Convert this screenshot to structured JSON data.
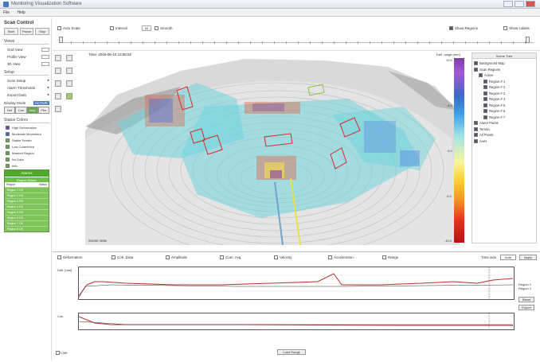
{
  "window": {
    "title": "Monitoring Visualization Software"
  },
  "menu": [
    "File",
    "Help"
  ],
  "sidebar": {
    "title": "Scan Control",
    "buttons": [
      "Start",
      "Pause",
      "Stop"
    ],
    "views_header": "Views",
    "views": [
      "Grid View",
      "Profile View",
      "3D View"
    ],
    "setup_header": "Setup",
    "setup": [
      "Scan Setup",
      "Alarm Thresholds",
      "Export Data"
    ],
    "display_mode_label": "Display Mode",
    "display_mode_tag": "ACTIVE",
    "modes": [
      "Def",
      "Coh",
      "Amp",
      "Phs"
    ],
    "legend_title": "Status Colors",
    "legend": [
      {
        "label": "High Deformation",
        "color": "#7b3fa8"
      },
      {
        "label": "Moderate Movement",
        "color": "#3f66c9"
      },
      {
        "label": "Stable Terrain",
        "color": "#6aa84f"
      },
      {
        "label": "Low Coherence",
        "color": "#6aa84f"
      },
      {
        "label": "Masked Region",
        "color": "#6aa84f"
      },
      {
        "label": "No Data",
        "color": "#6aa84f"
      },
      {
        "label": "Info",
        "color": "#6aa84f"
      }
    ],
    "table": {
      "header": "Alarms",
      "subheader": "Region Status",
      "columns": [
        "Region",
        "Status"
      ],
      "rows": [
        "Region 1  OK",
        "Region 2  OK",
        "Region 3  OK",
        "Region 4  OK",
        "Region 5  OK",
        "Region 6  OK",
        "Region 7  OK",
        "Region 8  OK"
      ]
    }
  },
  "top": {
    "chk_auto": "Auto Scale",
    "chk_interval": "Interval",
    "interval_value": "60",
    "chk_smooth": "Smooth",
    "chk_right1": "Show Regions",
    "chk_right2": "Show Labels"
  },
  "viewport": {
    "header": "Time: 2015-06-10 13:50:52",
    "footer": "Scene view",
    "colorbar_title": "Defl. range [mm]",
    "colorbar_ticks": [
      "10.0",
      "5.0",
      "0.0",
      "-5.0",
      "-10.0"
    ]
  },
  "tree": {
    "header": "Scene Tree",
    "items": [
      {
        "label": "Background Map",
        "indent": 0
      },
      {
        "label": "Scan Regions",
        "indent": 0
      },
      {
        "label": "Active",
        "indent": 1
      },
      {
        "label": "Region # 1",
        "indent": 2
      },
      {
        "label": "Region # 2",
        "indent": 2
      },
      {
        "label": "Region # 3",
        "indent": 2
      },
      {
        "label": "Region # 4",
        "indent": 2
      },
      {
        "label": "Region # 5",
        "indent": 2
      },
      {
        "label": "Region # 6",
        "indent": 2
      },
      {
        "label": "Region # 7",
        "indent": 2
      },
      {
        "label": "Alarm Points",
        "indent": 0
      },
      {
        "label": "Terrain",
        "indent": 0
      },
      {
        "label": "All Points",
        "indent": 0
      },
      {
        "label": "Axes",
        "indent": 0
      }
    ]
  },
  "bottom": {
    "checks": [
      "Deformation",
      "Coh. Data",
      "Amplitude",
      "Cum. Avg",
      "Velocity",
      "Acceleration",
      "Range"
    ],
    "select_label": "Time axis",
    "select_value": "Auto",
    "button": "Apply",
    "plot1_label": "Defl. [mm]",
    "plot2_label": "Coh.",
    "legend1": [
      "Region 1",
      "Region 2"
    ],
    "reset_label": "Reset",
    "export_label": "Export",
    "footer_left": "Live",
    "footer_button": "Load Range"
  },
  "colors": {
    "accent": "#4ea72e",
    "trace": "#b8312f"
  }
}
